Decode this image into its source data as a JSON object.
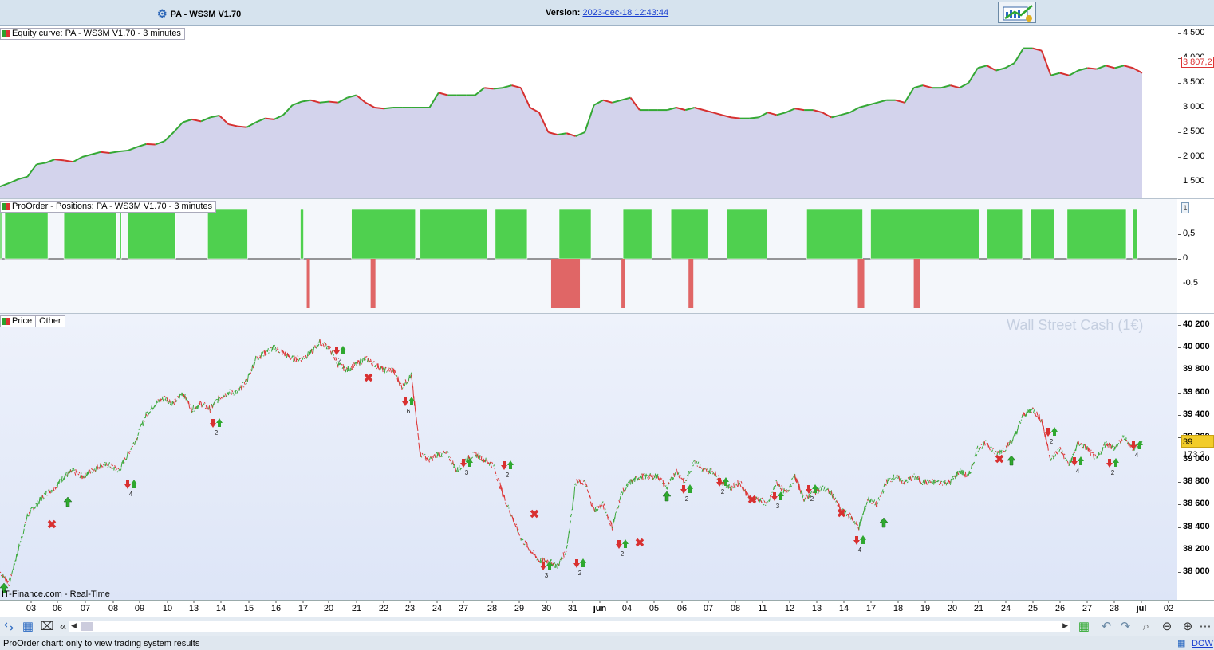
{
  "header": {
    "title": "PA - WS3M V1.70",
    "version_label": "Version:",
    "version_value": "2023-dec-18 12:43:44"
  },
  "equity": {
    "label": "Equity curve: PA - WS3M V1.70 - 3 minutes",
    "last_value": "3 807,2",
    "y_ticks": [
      "4 500",
      "4 000",
      "3 500",
      "3 000",
      "2 500",
      "2 000",
      "1 500"
    ],
    "series": [
      1400,
      1470,
      1550,
      1600,
      1850,
      1880,
      1950,
      1930,
      1900,
      2000,
      2050,
      2100,
      2080,
      2110,
      2130,
      2200,
      2260,
      2250,
      2320,
      2500,
      2700,
      2760,
      2720,
      2800,
      2840,
      2660,
      2620,
      2600,
      2700,
      2780,
      2760,
      2850,
      3050,
      3120,
      3150,
      3100,
      3120,
      3100,
      3200,
      3250,
      3100,
      3000,
      2980,
      3000,
      3000,
      3000,
      3000,
      3000,
      3300,
      3250,
      3250,
      3250,
      3250,
      3400,
      3380,
      3400,
      3450,
      3400,
      3000,
      2900,
      2500,
      2450,
      2480,
      2420,
      2500,
      3050,
      3150,
      3100,
      3150,
      3200,
      2950,
      2950,
      2950,
      2950,
      3000,
      2950,
      3000,
      2950,
      2900,
      2850,
      2800,
      2780,
      2780,
      2800,
      2900,
      2850,
      2900,
      2980,
      2950,
      2950,
      2900,
      2800,
      2850,
      2900,
      3000,
      3050,
      3100,
      3150,
      3150,
      3100,
      3400,
      3450,
      3400,
      3400,
      3450,
      3400,
      3500,
      3800,
      3850,
      3750,
      3800,
      3900,
      4200,
      4200,
      4150,
      3650,
      3700,
      3650,
      3750,
      3800,
      3780,
      3850,
      3800,
      3850,
      3800,
      3700
    ]
  },
  "positions": {
    "label": "ProOrder - Positions: PA - WS3M V1.70 - 3 minutes",
    "y_ticks": [
      "0,5",
      "0",
      "-0,5"
    ],
    "long_blocks": [
      [
        0,
        1
      ],
      [
        3,
        30
      ],
      [
        40,
        73
      ],
      [
        75,
        73
      ],
      [
        80,
        110
      ],
      [
        130,
        155
      ],
      [
        188,
        190
      ],
      [
        220,
        260
      ],
      [
        263,
        305
      ],
      [
        310,
        330
      ],
      [
        350,
        370
      ],
      [
        390,
        408
      ],
      [
        420,
        443
      ],
      [
        455,
        480
      ],
      [
        505,
        540
      ],
      [
        545,
        613
      ],
      [
        618,
        640
      ],
      [
        645,
        660
      ],
      [
        668,
        705
      ],
      [
        709,
        712
      ]
    ],
    "short_blocks": [
      [
        192,
        194
      ],
      [
        232,
        235
      ],
      [
        345,
        363
      ],
      [
        389,
        390
      ],
      [
        431,
        434
      ],
      [
        537,
        541
      ],
      [
        572,
        576
      ]
    ]
  },
  "price": {
    "tabs": [
      "Price",
      "Other"
    ],
    "instrument": "Wall Street Cash (1€)",
    "last_value": "39 173,2",
    "source": "IT-Finance.com - Real-Time",
    "y_ticks": [
      "40 200",
      "40 000",
      "39 800",
      "39 600",
      "39 400",
      "39 200",
      "39 000",
      "38 800",
      "38 600",
      "38 400",
      "38 200",
      "38 000"
    ],
    "series": [
      38000,
      37900,
      38200,
      38500,
      38600,
      38700,
      38750,
      38850,
      38900,
      38850,
      38900,
      38950,
      38950,
      38900,
      39050,
      39200,
      39400,
      39500,
      39550,
      39500,
      39600,
      39450,
      39500,
      39450,
      39550,
      39600,
      39600,
      39700,
      39900,
      39950,
      40000,
      39950,
      39900,
      39900,
      39950,
      40050,
      40000,
      39850,
      39800,
      39850,
      39900,
      39850,
      39800,
      39800,
      39650,
      39750,
      39050,
      39000,
      39050,
      39050,
      38900,
      39000,
      39050,
      39000,
      38950,
      38700,
      38500,
      38300,
      38200,
      38100,
      38100,
      38050,
      38200,
      38800,
      38800,
      38550,
      38600,
      38400,
      38700,
      38800,
      38850,
      38850,
      38850,
      38750,
      38900,
      38800,
      39000,
      38900,
      38900,
      38800,
      38750,
      38800,
      38650,
      38650,
      38600,
      38800,
      38700,
      38850,
      38650,
      38700,
      38750,
      38700,
      38550,
      38500,
      38400,
      38650,
      38600,
      38800,
      38850,
      38800,
      38850,
      38800,
      38800,
      38800,
      38800,
      38900,
      38850,
      39100,
      39150,
      39050,
      39100,
      39200,
      39400,
      39450,
      39350,
      39000,
      39100,
      38950,
      39150,
      39100,
      39000,
      39150,
      39100,
      39200,
      39100,
      39150
    ]
  },
  "xaxis": {
    "labels": [
      "03",
      "06",
      "07",
      "08",
      "09",
      "10",
      "13",
      "14",
      "15",
      "16",
      "17",
      "20",
      "21",
      "22",
      "23",
      "24",
      "27",
      "28",
      "29",
      "30",
      "31",
      "jun",
      "04",
      "05",
      "06",
      "07",
      "08",
      "11",
      "12",
      "13",
      "14",
      "17",
      "18",
      "19",
      "20",
      "21",
      "24",
      "25",
      "26",
      "27",
      "28",
      "jul",
      "02"
    ]
  },
  "status": {
    "text": "ProOrder chart: only to view trading system results",
    "right": "DOW"
  }
}
